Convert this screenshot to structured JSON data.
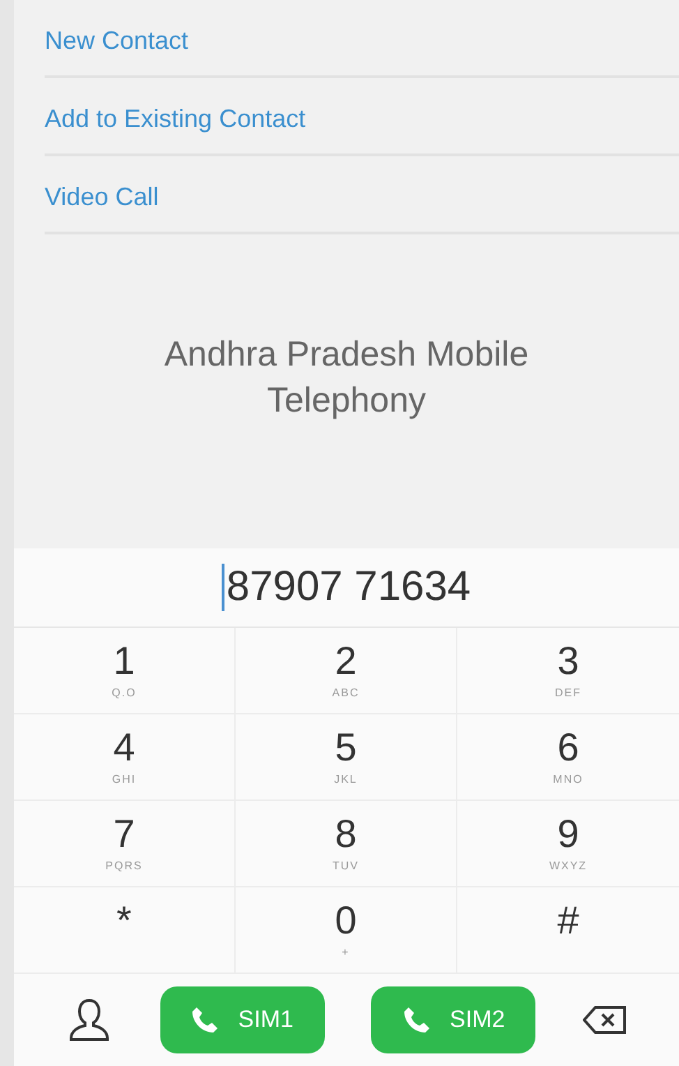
{
  "menu": [
    {
      "label": "New Contact"
    },
    {
      "label": "Add to Existing Contact"
    },
    {
      "label": "Video Call"
    }
  ],
  "carrier": "Andhra Pradesh Mobile Telephony",
  "number": "87907 71634",
  "keys": [
    {
      "digit": "1",
      "letters": "Q.O"
    },
    {
      "digit": "2",
      "letters": "ABC"
    },
    {
      "digit": "3",
      "letters": "DEF"
    },
    {
      "digit": "4",
      "letters": "GHI"
    },
    {
      "digit": "5",
      "letters": "JKL"
    },
    {
      "digit": "6",
      "letters": "MNO"
    },
    {
      "digit": "7",
      "letters": "PQRS"
    },
    {
      "digit": "8",
      "letters": "TUV"
    },
    {
      "digit": "9",
      "letters": "WXYZ"
    },
    {
      "digit": "*"
    },
    {
      "digit": "0",
      "letters": "+"
    },
    {
      "digit": "#"
    }
  ],
  "call_buttons": [
    {
      "label": "SIM1"
    },
    {
      "label": "SIM2"
    }
  ]
}
